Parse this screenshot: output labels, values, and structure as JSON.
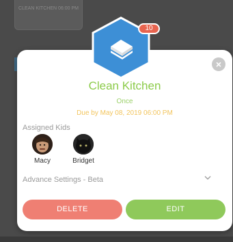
{
  "background": {
    "card_text": "CLEAN KITCHEN 06:00 PM"
  },
  "modal": {
    "close_icon": "close-icon",
    "task_icon": "sandwich-icon",
    "badge_count": "10",
    "title": "Clean Kitchen",
    "frequency": "Once",
    "due": "Due by May 08, 2019 06:00 PM",
    "assigned_label": "Assigned Kids",
    "kids": [
      {
        "name": "Macy"
      },
      {
        "name": "Bridget"
      }
    ],
    "advance_settings": "Advance Settings - Beta",
    "delete_label": "DELETE",
    "edit_label": "EDIT"
  },
  "colors": {
    "accent_green": "#8ccb4a",
    "due_yellow": "#f2c45c",
    "delete_red": "#ef7f73",
    "edit_green": "#8fc95b",
    "hex_blue": "#3d8fd6",
    "badge_red": "#e8644f"
  }
}
